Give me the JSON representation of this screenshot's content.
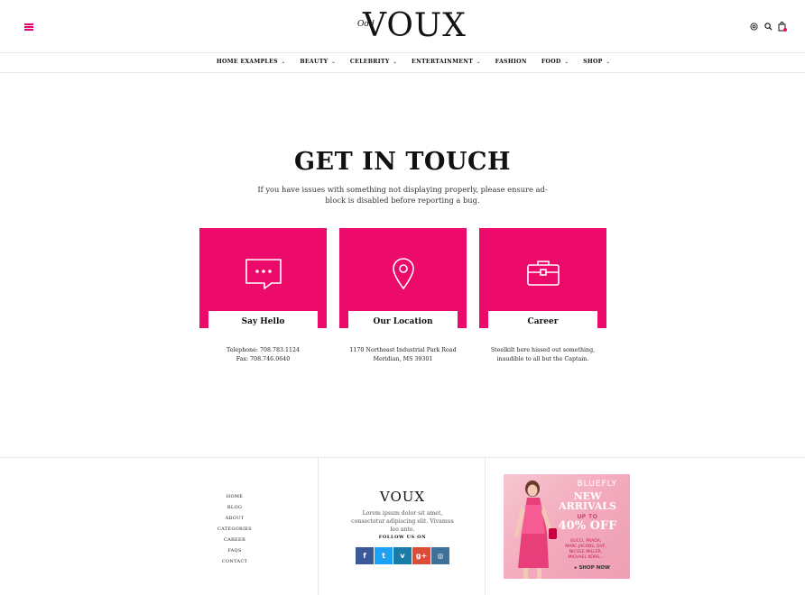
{
  "header": {
    "logo_main": "VOUX",
    "logo_small": "Odd"
  },
  "nav": {
    "items": [
      {
        "label": "HOME EXAMPLES",
        "has_dropdown": true
      },
      {
        "label": "BEAUTY",
        "has_dropdown": true
      },
      {
        "label": "CELEBRITY",
        "has_dropdown": true
      },
      {
        "label": "ENTERTAINMENT",
        "has_dropdown": true
      },
      {
        "label": "FASHION",
        "has_dropdown": false
      },
      {
        "label": "FOOD",
        "has_dropdown": true
      },
      {
        "label": "SHOP",
        "has_dropdown": true
      }
    ]
  },
  "main": {
    "title": "GET IN TOUCH",
    "subtitle": "If you have issues with something not displaying properly, please ensure ad-block is disabled before reporting a bug.",
    "cards": [
      {
        "icon": "chat-bubble-icon",
        "label": "Say Hello",
        "line1": "Telephone: 708.783.1124",
        "line2": "Fax: 708.746.0640"
      },
      {
        "icon": "location-pin-icon",
        "label": "Our Location",
        "line1": "1170 Northeast Industrial Park Road",
        "line2": "Meridian, MS 39301"
      },
      {
        "icon": "briefcase-icon",
        "label": "Career",
        "line1": "Steelkilt here hissed out something,",
        "line2": "inaudible to all but the Captain."
      }
    ]
  },
  "footer": {
    "links": [
      "HOME",
      "BLOG",
      "ABOUT",
      "CATEGORIES",
      "CAREER",
      "FAQS",
      "CONTACT"
    ],
    "logo": "VOUX",
    "description": "Lorem ipsum dolor sit amet, consectetur adipiscing elit. Vivamus leo ante.",
    "follow_label": "FOLLOW US ON",
    "socials": [
      {
        "name": "facebook-icon",
        "glyph": "f",
        "color": "#3b5998"
      },
      {
        "name": "twitter-icon",
        "glyph": "t",
        "color": "#1da1f2"
      },
      {
        "name": "vimeo-icon",
        "glyph": "v",
        "color": "#1a7ba6"
      },
      {
        "name": "google-plus-icon",
        "glyph": "g+",
        "color": "#dd4b39"
      },
      {
        "name": "instagram-icon",
        "glyph": "◎",
        "color": "#3f729b"
      }
    ],
    "ad": {
      "brand": "BLUEFLY",
      "headline_line1": "NEW",
      "headline_line2": "ARRIVALS",
      "up_to": "UP TO",
      "discount": "40% OFF",
      "brands_line1": "GUCCI, PRADA,",
      "brands_line2": "MARC JACOBS, DVF,",
      "brands_line3": "NICOLE MILLER,",
      "brands_line4": "MICHAEL KORS...",
      "cta": "▸ SHOP NOW"
    }
  },
  "colors": {
    "accent": "#ec0a6a"
  }
}
